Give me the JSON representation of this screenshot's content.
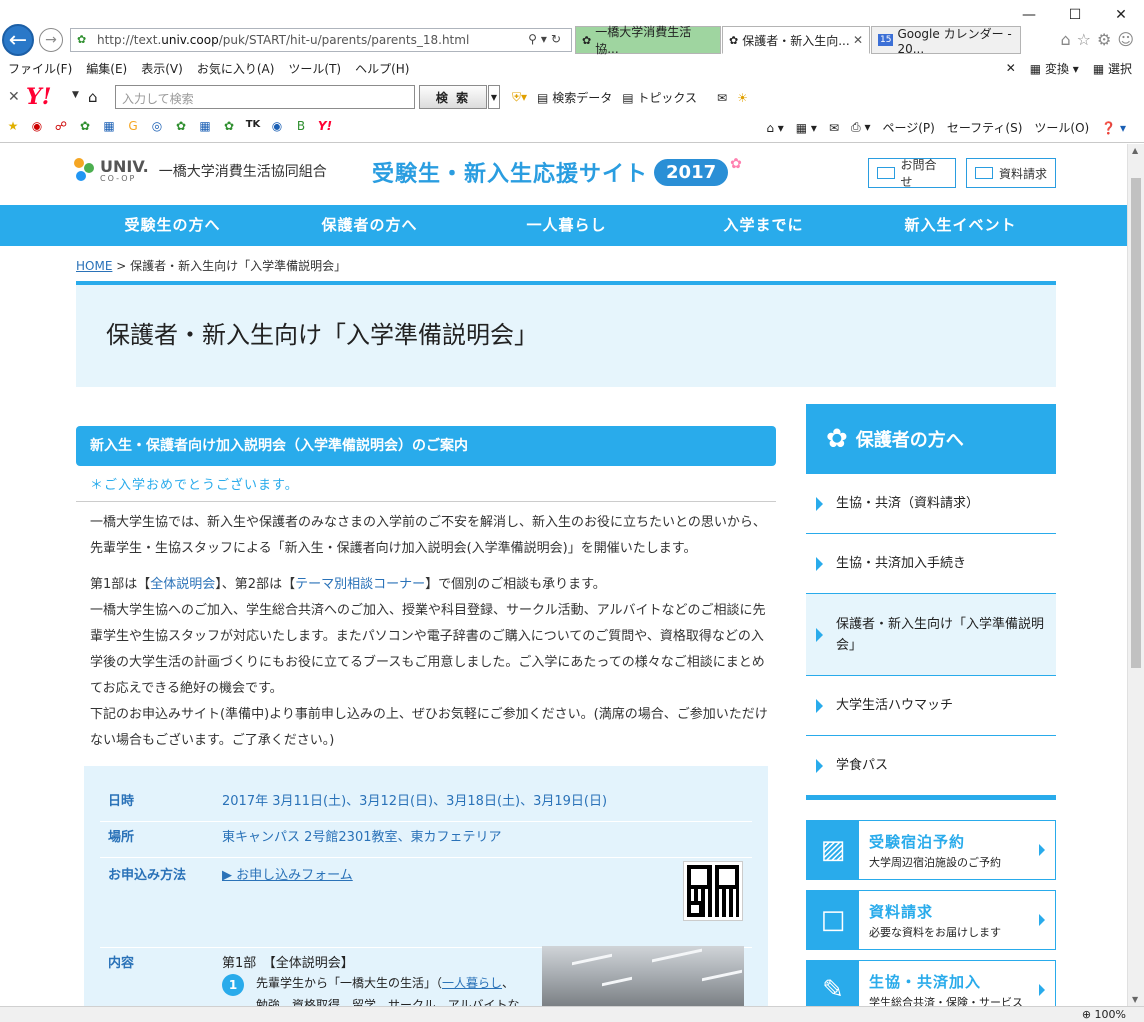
{
  "browser": {
    "address": "http://text.univ.coop/puk/START/hit-u/parents/parents_18.html",
    "tabs": [
      {
        "label": "一橋大学消費生活協...",
        "active": false
      },
      {
        "label": "保護者・新入生向...",
        "active": true
      },
      {
        "label": "Google カレンダー - 20...",
        "active": false
      }
    ],
    "menu": [
      "ファイル(F)",
      "編集(E)",
      "表示(V)",
      "お気に入り(A)",
      "ツール(T)",
      "ヘルプ(H)"
    ],
    "menu_right": [
      "変換",
      "選択"
    ],
    "yahoo": {
      "search_placeholder": "入力して検索",
      "search_button": "検 索",
      "tool1": "検索データ",
      "tool2": "トピックス"
    },
    "command_bar": [
      "ページ(P)",
      "セーフティ(S)",
      "ツール(O)"
    ],
    "zoom": "100%"
  },
  "site": {
    "org_name": "一橋大学消費生活協同組合",
    "logo_univ": "UNIV.",
    "logo_coop": "CO-OP",
    "banner_text": "受験生・新入生応援サイト",
    "banner_year": "2017",
    "contact_button": "お問合せ",
    "request_button": "資料請求",
    "nav": [
      "受験生の方へ",
      "保護者の方へ",
      "一人暮らし",
      "入学までに",
      "新入生イベント"
    ]
  },
  "breadcrumb": {
    "home": "HOME",
    "sep": ">",
    "current": "保護者・新入生向け「入学準備説明会」"
  },
  "page_title": "保護者・新入生向け「入学準備説明会」",
  "main": {
    "section_heading": "新入生・保護者向け加入説明会（入学準備説明会）のご案内",
    "sub_heading": "＊ご入学おめでとうございます。",
    "para1": "一橋大学生協では、新入生や保護者のみなさまの入学前のご不安を解消し、新入生のお役に立ちたいとの思いから、先輩学生・生協スタッフによる「新入生・保護者向け加入説明会(入学準備説明会)」を開催いたします。",
    "para2_pre": "第1部は【",
    "para2_link1": "全体説明会",
    "para2_mid": "】、第2部は【",
    "para2_link2": "テーマ別相談コーナー",
    "para2_post": "】で個別のご相談も承ります。",
    "para3": "一橋大学生協へのご加入、学生総合共済へのご加入、授業や科目登録、サークル活動、アルバイトなどのご相談に先輩学生や生協スタッフが対応いたします。またパソコンや電子辞書のご購入についてのご質問や、資格取得などの入学後の大学生活の計画づくりにもお役に立てるブースもご用意しました。ご入学にあたっての様々なご相談にまとめてお応えできる絶好の機会です。",
    "para4": "下記のお申込みサイト(準備中)より事前申し込みの上、ぜひお気軽にご参加ください。(満席の場合、ご参加いただけない場合もございます。ご了承ください。)",
    "info": {
      "date_label": "日時",
      "date_value": "2017年 3月11日(土)、3月12日(日)、3月18日(土)、3月19日(日)",
      "place_label": "場所",
      "place_value": "東キャンパス 2号館2301教室、東カフェテリア",
      "apply_label": "お申込み方法",
      "apply_value": "▶ お申し込みフォーム",
      "content_label": "内容",
      "part1": "第1部　【全体説明会】",
      "item1_num": "1",
      "item1_pre": "先輩学生から「一橋大生の生活」（",
      "item1_link": "一人暮らし",
      "item1_post": "、勉強、資格取得、留学、サークル、アルバイトなど）"
    }
  },
  "sidebar": {
    "heading": "保護者の方へ",
    "items": [
      "生協・共済（資料請求）",
      "生協・共済加入手続き",
      "保護者・新入生向け「入学準備説明会」",
      "大学生活ハウマッチ",
      "学食パス"
    ],
    "banners": [
      {
        "title": "受験宿泊予約",
        "sub": "大学周辺宿泊施設のご予約"
      },
      {
        "title": "資料請求",
        "sub": "必要な資料をお届けします"
      },
      {
        "title": "生協・共済加入",
        "sub": "学生総合共済・保険・サービス"
      }
    ]
  }
}
